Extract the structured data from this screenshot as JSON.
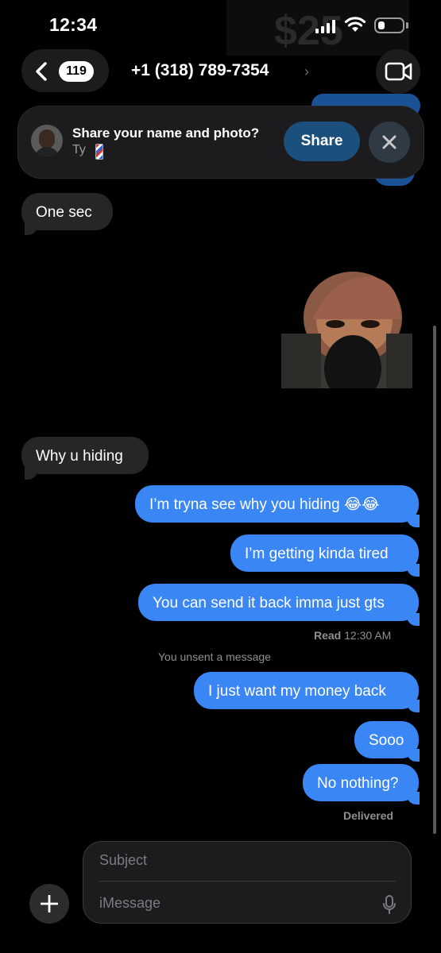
{
  "status_bar": {
    "time": "12:34",
    "background_amount": "$25"
  },
  "nav": {
    "back_count": "119",
    "contact": "+1 (318) 789-7354",
    "title_chevron": "›"
  },
  "share_banner": {
    "title": "Share your name and photo?",
    "subtitle": "Ty",
    "share_label": "Share"
  },
  "messages": {
    "m1": "One sec",
    "m2": "Why u hiding",
    "m3": "I’m tryna see why you hiding 😂😂",
    "m4": "I’m getting kinda tired",
    "m5": "You can send it back imma just gts",
    "read_label": "Read",
    "read_time": "12:30 AM",
    "unsent": "You unsent a message",
    "m6": "I just want my money back",
    "m7": "Sooo",
    "m8": "No nothing?",
    "delivered": "Delivered"
  },
  "composer": {
    "subject_placeholder": "Subject",
    "message_placeholder": "iMessage"
  },
  "colors": {
    "sent_bubble": "#3b86f5",
    "received_bubble": "#262628",
    "share_button": "#1b4f7c"
  },
  "icons": [
    "signal-icon",
    "wifi-icon",
    "battery-icon",
    "chevron-back-icon",
    "video-call-icon",
    "close-icon",
    "barber-pole-icon",
    "plus-icon",
    "microphone-icon"
  ],
  "battery_level": 0.3
}
